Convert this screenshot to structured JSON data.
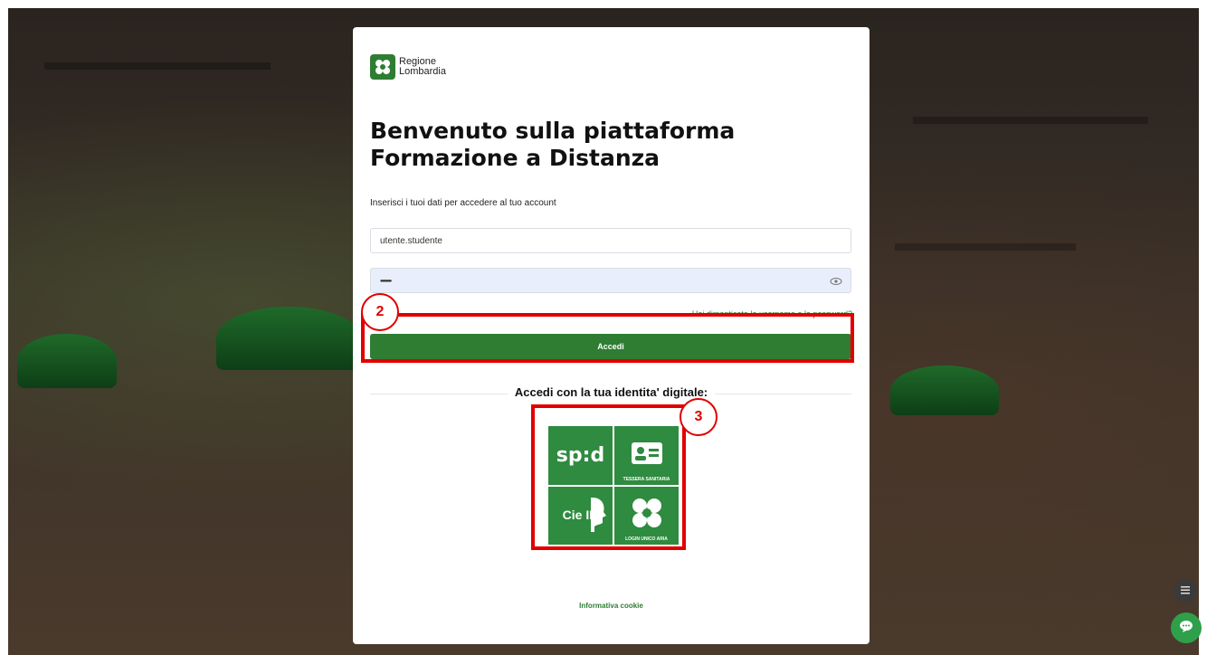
{
  "brand": {
    "logo_line1": "Regione",
    "logo_line2": "Lombardia",
    "brand_color": "#2e7d32"
  },
  "login": {
    "title_line1": "Benvenuto sulla piattaforma",
    "title_line2": "Formazione a Distanza",
    "subtitle": "Inserisci i tuoi dati per accedere al tuo account",
    "username_value": "utente.studente",
    "password_value": "••••••••••••••",
    "forgot_link": "Hai dimenticato lo username o la password?",
    "submit_label": "Accedi"
  },
  "digital_identity": {
    "heading": "Accedi con la tua identita' digitale:",
    "spid_label": "sp:d",
    "ts_caption": "TESSERA SANITARIA",
    "cie_label": "Cie ID",
    "aria_caption": "LOGIN UNICO ARIA"
  },
  "footer": {
    "cookie_link": "Informativa cookie"
  },
  "annotations": {
    "badge_2": "2",
    "badge_3": "3",
    "annotation_color": "#e10000"
  },
  "floating": {
    "menu_icon": "menu-icon",
    "chat_icon": "chat-icon"
  }
}
